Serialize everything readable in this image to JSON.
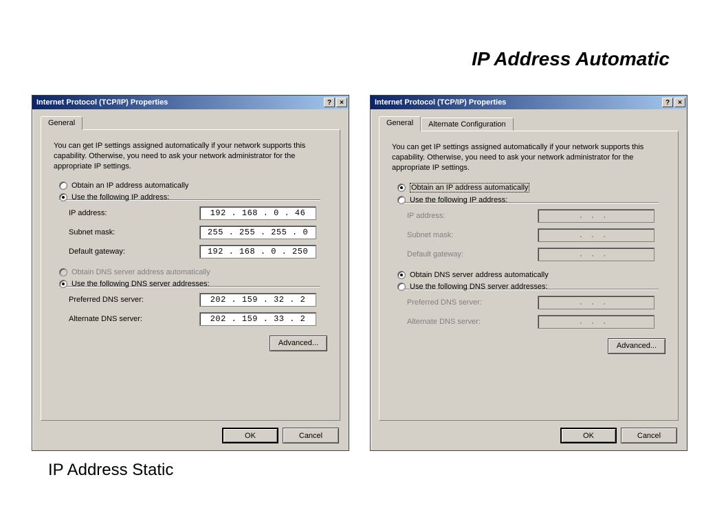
{
  "slide": {
    "title_automatic": "IP Address Automatic",
    "caption_static": "IP Address Static"
  },
  "dialog_left": {
    "title": "Internet Protocol (TCP/IP) Properties",
    "help_btn": "?",
    "close_btn": "×",
    "tabs": {
      "general": "General"
    },
    "desc": "You can get IP settings assigned automatically if your network supports this capability. Otherwise, you need to ask your network administrator for the appropriate IP settings.",
    "radio_obtain_ip": "Obtain an IP address automatically",
    "radio_use_ip": "Use the following IP address:",
    "ip_mode": "use",
    "fields": {
      "ip_label": "IP address:",
      "ip_value": "192 . 168 .  0  .  46",
      "subnet_label": "Subnet mask:",
      "subnet_value": "255 . 255 . 255 .  0",
      "gateway_label": "Default gateway:",
      "gateway_value": "192 . 168 .  0  . 250"
    },
    "radio_obtain_dns": "Obtain DNS server address automatically",
    "radio_use_dns": "Use the following DNS server addresses:",
    "dns_mode": "use",
    "dns_fields": {
      "preferred_label": "Preferred DNS server:",
      "preferred_value": "202 . 159 . 32 .  2",
      "alternate_label": "Alternate DNS server:",
      "alternate_value": "202 . 159 . 33 .  2"
    },
    "advanced_btn": "Advanced...",
    "ok_btn": "OK",
    "cancel_btn": "Cancel"
  },
  "dialog_right": {
    "title": "Internet Protocol (TCP/IP) Properties",
    "help_btn": "?",
    "close_btn": "×",
    "tabs": {
      "general": "General",
      "alternate": "Alternate Configuration"
    },
    "desc": "You can get IP settings assigned automatically if your network supports this capability. Otherwise, you need to ask your network administrator for the appropriate IP settings.",
    "radio_obtain_ip": "Obtain an IP address automatically",
    "radio_use_ip": "Use the following IP address:",
    "ip_mode": "obtain",
    "fields": {
      "ip_label": "IP address:",
      "ip_value": "",
      "subnet_label": "Subnet mask:",
      "subnet_value": "",
      "gateway_label": "Default gateway:",
      "gateway_value": ""
    },
    "radio_obtain_dns": "Obtain DNS server address automatically",
    "radio_use_dns": "Use the following DNS server addresses:",
    "dns_mode": "obtain",
    "dns_fields": {
      "preferred_label": "Preferred DNS server:",
      "preferred_value": "",
      "alternate_label": "Alternate DNS server:",
      "alternate_value": ""
    },
    "advanced_btn": "Advanced...",
    "ok_btn": "OK",
    "cancel_btn": "Cancel"
  }
}
